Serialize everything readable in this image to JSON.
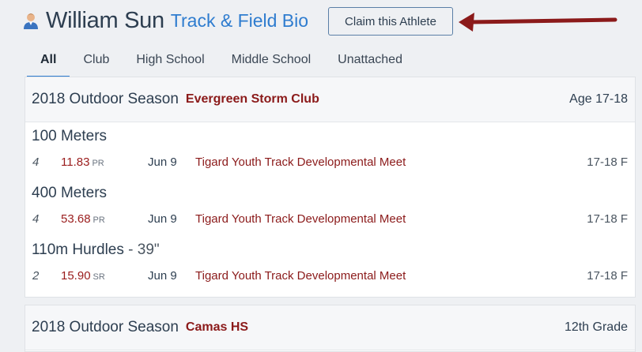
{
  "header": {
    "athlete_name": "William Sun",
    "bio_title": "Track & Field Bio",
    "claim_label": "Claim this Athlete"
  },
  "tabs": [
    {
      "label": "All",
      "active": true
    },
    {
      "label": "Club",
      "active": false
    },
    {
      "label": "High School",
      "active": false
    },
    {
      "label": "Middle School",
      "active": false
    },
    {
      "label": "Unattached",
      "active": false
    }
  ],
  "seasons": [
    {
      "season": "2018 Outdoor Season",
      "team": "Evergreen Storm Club",
      "level": "Age 17-18",
      "events": [
        {
          "title": "100 Meters",
          "subtitle": "",
          "place": "4",
          "mark": "11.83",
          "tag": "PR",
          "date": "Jun 9",
          "meet": "Tigard Youth Track Developmental Meet",
          "division": "17-18 F"
        },
        {
          "title": "400 Meters",
          "subtitle": "",
          "place": "4",
          "mark": "53.68",
          "tag": "PR",
          "date": "Jun 9",
          "meet": "Tigard Youth Track Developmental Meet",
          "division": "17-18 F"
        },
        {
          "title": "110m Hurdles",
          "subtitle": "- 39\"",
          "place": "2",
          "mark": "15.90",
          "tag": "SR",
          "date": "Jun 9",
          "meet": "Tigard Youth Track Developmental Meet",
          "division": "17-18 F"
        }
      ]
    },
    {
      "season": "2018 Outdoor Season",
      "team": "Camas HS",
      "level": "12th Grade",
      "events": []
    }
  ],
  "colors": {
    "accent_blue": "#2e7ccf",
    "team_red": "#8b1a1a",
    "arrow": "#8b1a1a"
  },
  "icons": {
    "athlete": "person-icon",
    "annotation": "arrow-icon"
  }
}
